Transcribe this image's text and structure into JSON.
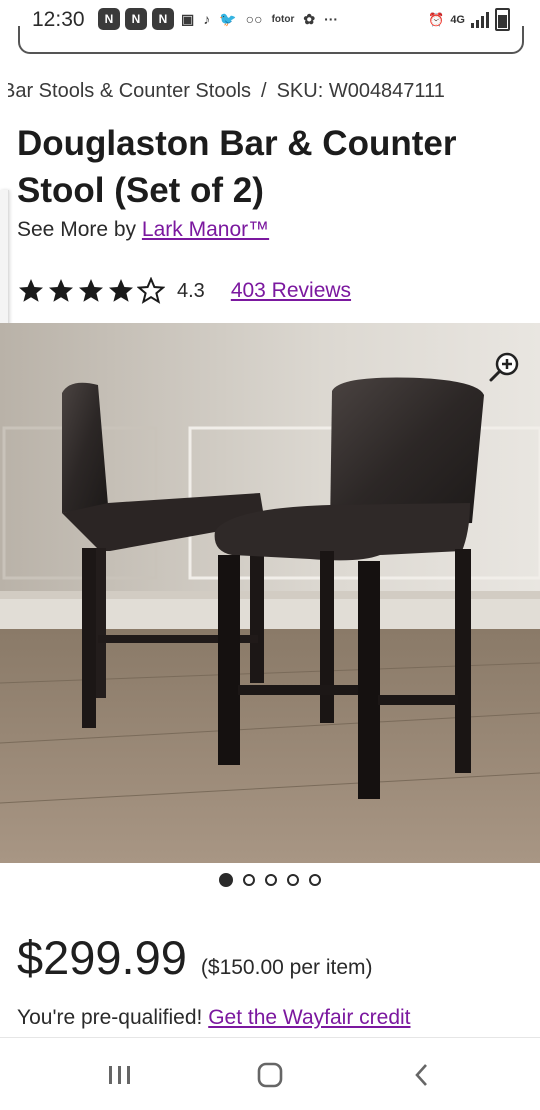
{
  "status_bar": {
    "time": "12:30",
    "notifications": [
      "N",
      "N",
      "N",
      "▣",
      "♪",
      "🐦",
      "○○",
      "fotor",
      "✿",
      "···"
    ],
    "network": "4G"
  },
  "breadcrumb": {
    "category": "Bar Stools & Counter Stools",
    "separator": "/",
    "sku": "SKU: W004847111"
  },
  "product": {
    "title": "Douglaston Bar & Counter Stool (Set of 2)",
    "see_more_prefix": "See More by",
    "brand": "Lark Manor™",
    "rating": 4.3,
    "rating_text": "4.3",
    "stars_total": 5,
    "reviews_label": "403 Reviews",
    "image_count": 5,
    "active_image_index": 0,
    "price": "$299.99",
    "per_item": "($150.00 per item)",
    "prequal_text": "You're pre-qualified!",
    "credit_link": "Get the Wayfair credit"
  },
  "icons": {
    "zoom": "zoom-in-icon",
    "star_full": "star-filled-icon",
    "star_empty": "star-outline-icon"
  },
  "colors": {
    "link": "#7b189f",
    "text": "#1f1f1f",
    "star": "#1a1a1a"
  },
  "nav_bar": [
    "recent-apps",
    "home",
    "back"
  ]
}
